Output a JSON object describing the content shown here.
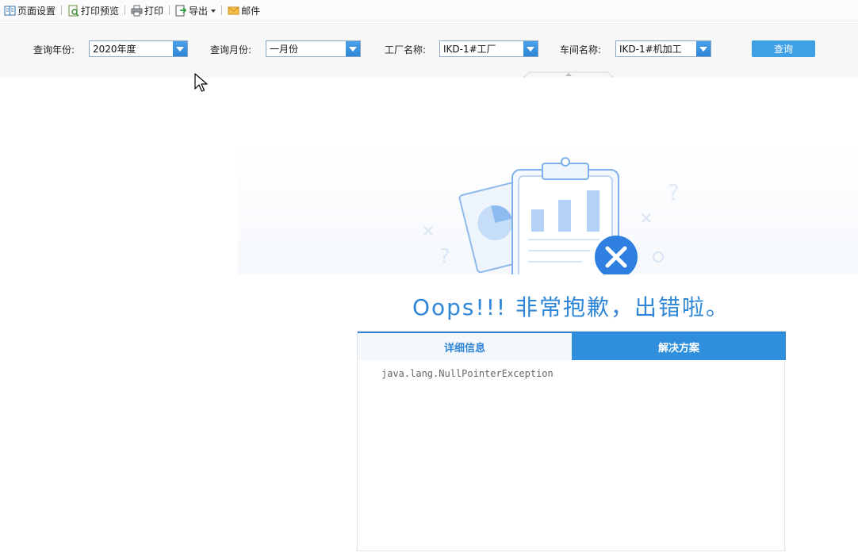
{
  "toolbar": {
    "items": [
      {
        "label": "页面设置",
        "icon": "page-setup-icon"
      },
      {
        "label": "打印预览",
        "icon": "print-preview-icon"
      },
      {
        "label": "打印",
        "icon": "printer-icon"
      },
      {
        "label": "导出",
        "icon": "export-icon"
      },
      {
        "label": "邮件",
        "icon": "mail-icon"
      }
    ]
  },
  "filters": {
    "year": {
      "label": "查询年份:",
      "value": "2020年度"
    },
    "month": {
      "label": "查询月份:",
      "value": "一月份"
    },
    "factory": {
      "label": "工厂名称:",
      "value": "IKD-1#工厂"
    },
    "workshop": {
      "label": "车间名称:",
      "value": "IKD-1#机加工"
    },
    "query_label": "查询"
  },
  "error": {
    "title": "Oops!!! 非常抱歉，出错啦。",
    "tabs": [
      {
        "label": "详细信息",
        "active": true
      },
      {
        "label": "解决方案",
        "active": false
      }
    ],
    "detail": "java.lang.NullPointerException"
  },
  "colors": {
    "accent": "#2f86d6",
    "button": "#3fa0e6"
  }
}
